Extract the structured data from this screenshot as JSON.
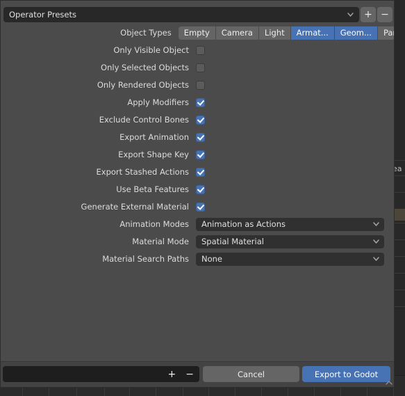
{
  "dialog": {
    "preset": {
      "label": "Operator Presets",
      "dropdown_icon": "chevron-down-icon",
      "add_label": "+",
      "remove_label": "−"
    },
    "object_types": {
      "label": "Object Types",
      "options": [
        {
          "label": "Empty",
          "selected": false
        },
        {
          "label": "Camera",
          "selected": false
        },
        {
          "label": "Light",
          "selected": false
        },
        {
          "label": "Armat...",
          "selected": true
        },
        {
          "label": "Geom...",
          "selected": true
        },
        {
          "label": "Particle",
          "selected": false
        }
      ]
    },
    "checkboxes": [
      {
        "label": "Only Visible Object",
        "checked": false
      },
      {
        "label": "Only Selected Objects",
        "checked": false
      },
      {
        "label": "Only Rendered Objects",
        "checked": false
      },
      {
        "label": "Apply Modifiers",
        "checked": true
      },
      {
        "label": "Exclude Control Bones",
        "checked": true
      },
      {
        "label": "Export Animation",
        "checked": true
      },
      {
        "label": "Export Shape Key",
        "checked": true
      },
      {
        "label": "Export Stashed Actions",
        "checked": true
      },
      {
        "label": "Use Beta Features",
        "checked": true
      },
      {
        "label": "Generate External Material",
        "checked": true
      }
    ],
    "dropdowns": [
      {
        "label": "Animation Modes",
        "value": "Animation as Actions",
        "icon": "chevron-down-icon"
      },
      {
        "label": "Material Mode",
        "value": "Spatial Material",
        "icon": "chevron-down-icon"
      },
      {
        "label": "Material Search Paths",
        "value": "None",
        "icon": "chevron-down-icon"
      }
    ],
    "footer": {
      "filename_value": "",
      "filename_placeholder": "",
      "increment_label": "+",
      "decrement_label": "−",
      "cancel_label": "Cancel",
      "confirm_label": "Export to Godot",
      "resize_grip_icon": "chevron-up-icon"
    }
  },
  "background": {
    "outliner_partial_text": "ea"
  },
  "colors": {
    "accent": "#4772b3",
    "dialog_bg": "#4b4b4b",
    "field_bg": "#282828",
    "button_bg": "#656565",
    "text": "#e3e3e3"
  }
}
